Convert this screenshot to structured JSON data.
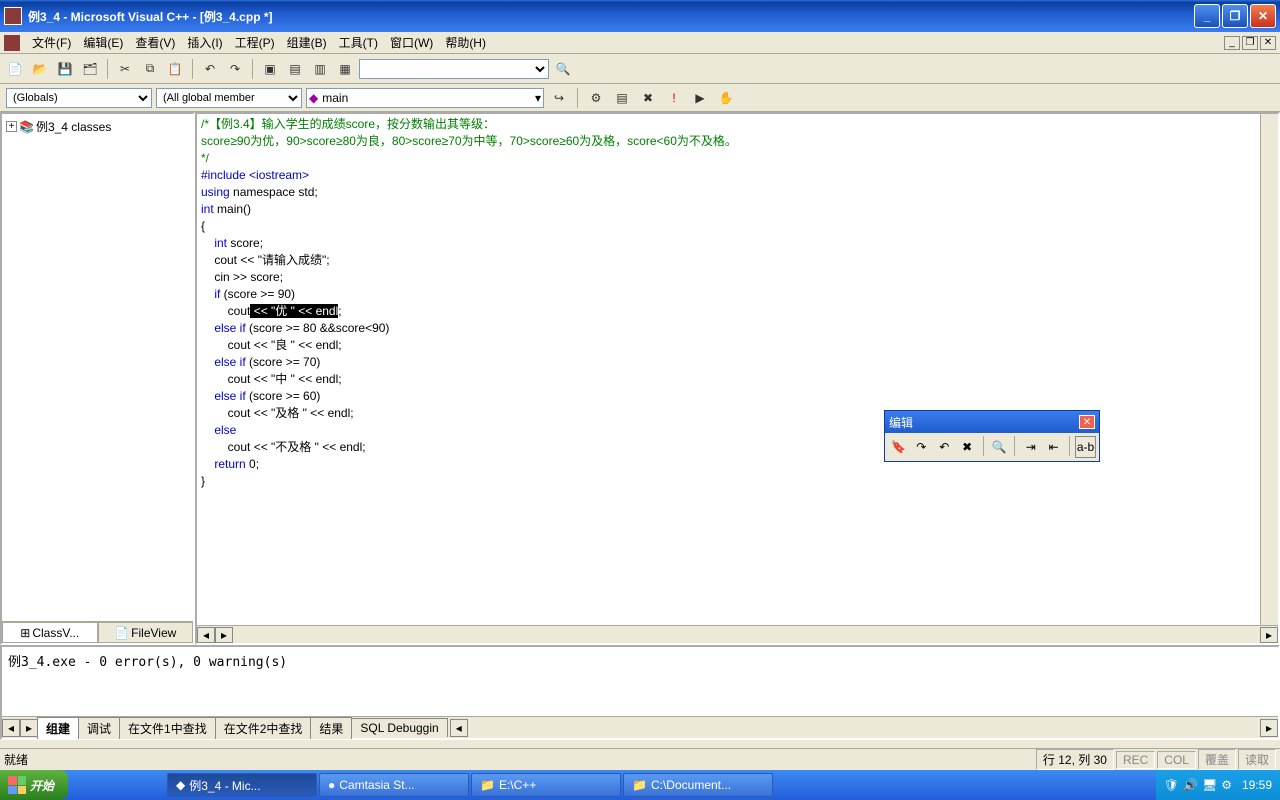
{
  "window": {
    "title": "例3_4 - Microsoft Visual C++ - [例3_4.cpp *]"
  },
  "menu": {
    "items": [
      "文件(F)",
      "编辑(E)",
      "查看(V)",
      "插入(I)",
      "工程(P)",
      "组建(B)",
      "工具(T)",
      "窗口(W)",
      "帮助(H)"
    ]
  },
  "context": {
    "scope": "(Globals)",
    "members": "(All global member",
    "func_icon": "◆",
    "func": "main"
  },
  "tree": {
    "root": "例3_4 classes"
  },
  "sidetabs": {
    "class": "ClassV...",
    "file": "FileView"
  },
  "code": {
    "c1": "/*【例3.4】输入学生的成绩score，按分数输出其等级：",
    "c2": "score≥90为优，90>score≥80为良，80>score≥70为中等，70>score≥60为及格，score<60为不及格。",
    "c3": "*/",
    "l4": "#include <iostream>",
    "l5a": "using",
    "l5b": " namespace std;",
    "l6a": "int",
    "l6b": " main()",
    "l7": "{",
    "l8a": "    int",
    "l8b": " score;",
    "l9": "    cout << \"请输入成绩\";",
    "l10": "    cin >> score;",
    "l11a": "    if",
    "l11b": " (score >= 90)",
    "l12a": "        cout",
    "l12sel": " << \"优 \" << endl",
    "l12b": ";",
    "l13a": "    else if",
    "l13b": " (score >= 80 &&score<90)",
    "l14": "        cout << \"良 \" << endl;",
    "l15a": "    else if",
    "l15b": " (score >= 70)",
    "l16": "        cout << \"中 \" << endl;",
    "l17a": "    else if",
    "l17b": " (score >= 60)",
    "l18": "        cout << \"及格 \" << endl;",
    "l19": "    else",
    "l20": "        cout << \"不及格 \" << endl;",
    "l21a": "    return",
    "l21b": " 0;",
    "l22": "}"
  },
  "output": {
    "text": "例3_4.exe - 0 error(s), 0 warning(s)",
    "tabs": [
      "组建",
      "调试",
      "在文件1中查找",
      "在文件2中查找",
      "结果",
      "SQL Debuggin"
    ]
  },
  "status": {
    "ready": "就绪",
    "pos": "行 12, 列 30",
    "ind": [
      "REC",
      "COL",
      "覆盖",
      "读取"
    ]
  },
  "float": {
    "title": "编辑",
    "ab": "a-b"
  },
  "taskbar": {
    "start": "开始",
    "tasks": [
      "例3_4 - Mic...",
      "Camtasia St...",
      "E:\\C++",
      "C:\\Document..."
    ],
    "clock": "19:59"
  }
}
